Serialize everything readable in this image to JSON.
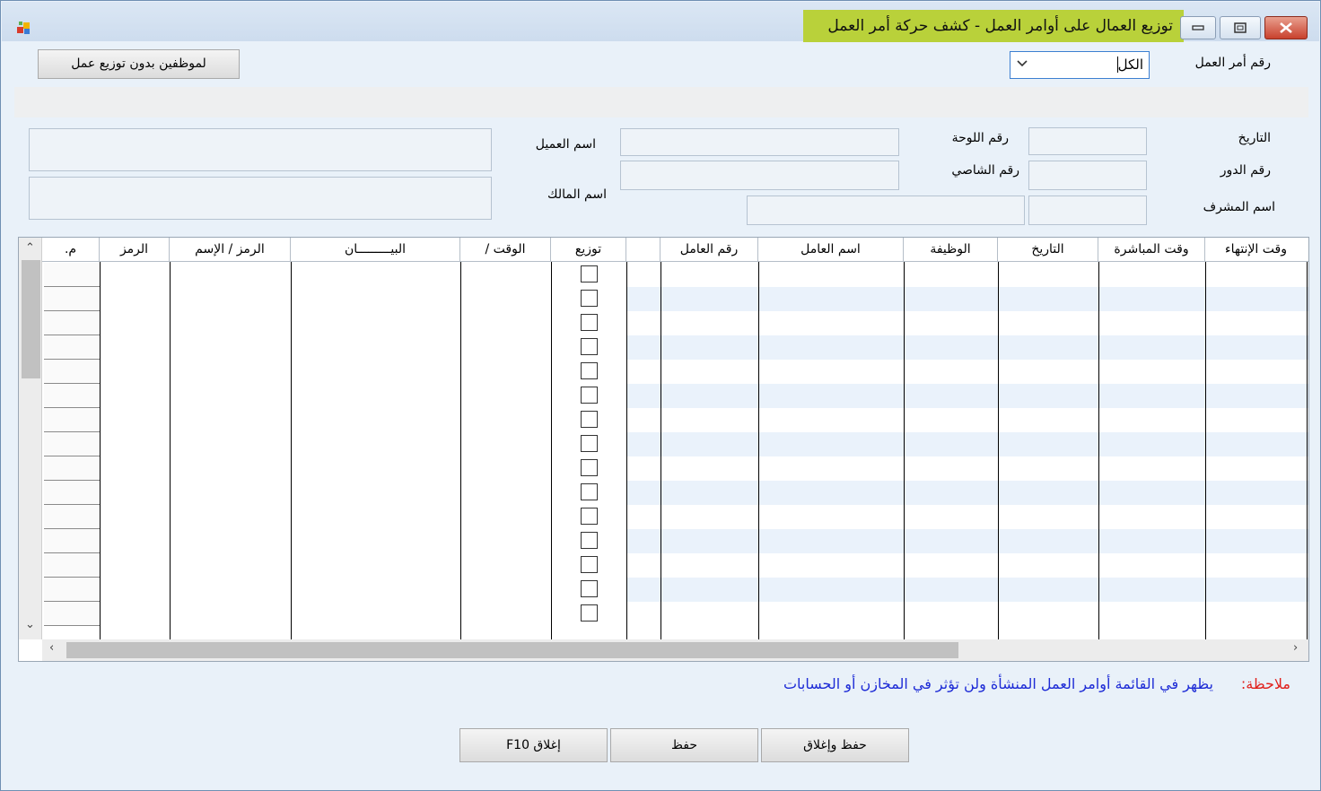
{
  "window": {
    "title": "توزيع العمال على أوامر العمل - كشف حركة أمر العمل"
  },
  "top": {
    "employees_button": "لموظفين بدون توزيع عمل",
    "order_label": "رقم أمر العمل",
    "order_value": "الكل"
  },
  "fields": {
    "date_label": "التاريخ",
    "plate_label": "رقم اللوحة",
    "customer_label": "اسم العميل",
    "turn_label": "رقم الدور",
    "chassis_label": "رقم الشاصي",
    "owner_label": "اسم المالك",
    "supervisor_label": "اسم المشرف"
  },
  "grid": {
    "columns": {
      "end_time": "وقت الإنتهاء",
      "start_time": "وقت المباشرة",
      "date": "التاريخ",
      "job": "الوظيفة",
      "worker_name": "اسم العامل",
      "worker_no": "رقم العامل",
      "distribute": "توزيع",
      "time": "الوقت /",
      "description": "البيـــــــــان",
      "code_name": "الرمز / الإسم",
      "code": "الرمز",
      "seq": "م."
    },
    "row_count": 15
  },
  "note": {
    "label": "ملاحظة:",
    "text": "يظهر في القائمة أوامر العمل المنشأة ولن تؤثر في المخازن أو الحسابات",
    "label_color": "#e0201b",
    "text_color": "#1d2bd6"
  },
  "buttons": {
    "save_close": "حفظ وإغلاق",
    "save": "حفظ",
    "close": "إغلاق F10"
  }
}
